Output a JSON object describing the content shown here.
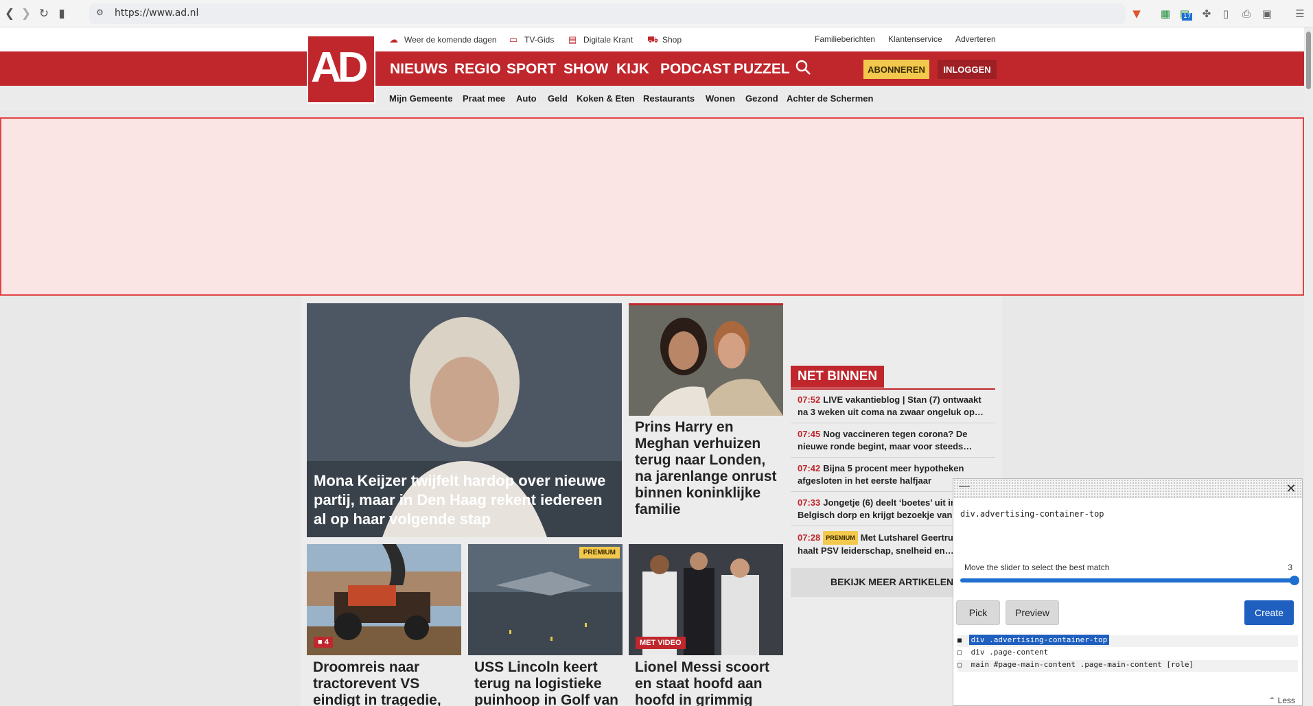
{
  "browser": {
    "url": "https://www.ad.nl",
    "ext_badge": "17"
  },
  "util_links": {
    "weather": "Weer de komende dagen",
    "tv": "TV-Gids",
    "krant": "Digitale Krant",
    "shop": "Shop",
    "familie": "Familieberichten",
    "klanten": "Klantenservice",
    "adverteren": "Adverteren"
  },
  "logo": "AD",
  "nav": [
    "NIEUWS",
    "REGIO",
    "SPORT",
    "SHOW",
    "KIJK",
    "PODCAST",
    "PUZZEL"
  ],
  "buttons": {
    "abonneren": "ABONNEREN",
    "inloggen": "INLOGGEN"
  },
  "sub_nav": [
    "Mijn Gemeente",
    "Praat mee",
    "Auto",
    "Geld",
    "Koken & Eten",
    "Restaurants",
    "Wonen",
    "Gezond",
    "Achter de Schermen"
  ],
  "articles": {
    "hero": "Mona Keijzer twijfelt hardop over nieuwe partij, maar in Den Haag rekent iedereen al op haar volgende stap",
    "harry": "Prins Harry en Meghan verhuizen terug naar Londen, na jarenlange onrust binnen koninklijke familie",
    "tractor": "Droomreis naar tractorevent VS eindigt in tragedie,",
    "tractor_comments": "4",
    "lincoln": "USS Lincoln keert terug na logistieke puinhoop in Golf van",
    "lincoln_badge": "PREMIUM",
    "messi": "Lionel Messi scoort en staat hoofd aan hoofd in grimmig",
    "messi_badge": "MET VIDEO"
  },
  "net_binnen": {
    "title": "NET BINNEN",
    "items": [
      {
        "time": "07:52",
        "text": "LIVE vakantieblog | Stan (7) ontwaakt na 3 weken uit coma na zwaar ongeluk op…"
      },
      {
        "time": "07:45",
        "text": "Nog vaccineren tegen corona? De nieuwe ronde begint, maar voor steeds…"
      },
      {
        "time": "07:42",
        "text": "Bijna 5 procent meer hypotheken afgesloten in het eerste halfjaar"
      },
      {
        "time": "07:33",
        "text": "Jongetje (6) deelt ‘boetes’ uit in Belgisch dorp en krijgt bezoekje van de…"
      },
      {
        "time": "07:28",
        "badge": "PREMIUM",
        "text": "Met Lutsharel Geertruida haalt PSV leiderschap, snelheid en…"
      }
    ],
    "more": "BEKIJK MEER ARTIKELEN"
  },
  "picker": {
    "selector": "div.advertising-container-top",
    "hint": "Move the slider to select the best match",
    "count": "3",
    "pick": "Pick",
    "preview": "Preview",
    "create": "Create",
    "candidates": [
      "div .advertising-container-top",
      "div .page-content",
      "main #page-main-content .page-main-content [role]"
    ],
    "less": "Less"
  },
  "colors": {
    "brand_red": "#c0272d",
    "premium_yellow": "#f2c94c",
    "picker_blue": "#1f5fbf"
  }
}
